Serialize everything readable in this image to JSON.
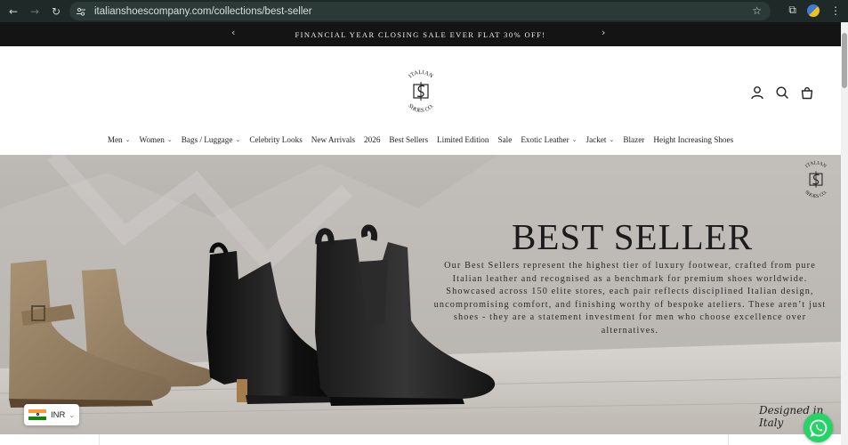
{
  "browser": {
    "url": "italianshoescompany.com/collections/best-seller"
  },
  "announcement": {
    "text": "FINANCIAL YEAR CLOSING SALE EVER FLAT 30% OFF!"
  },
  "logo": {
    "top_text": "ITALIAN",
    "bottom_text": "SHOES CO."
  },
  "nav": {
    "items": [
      {
        "label": "Men",
        "dropdown": true
      },
      {
        "label": "Women",
        "dropdown": true
      },
      {
        "label": "Bags / Luggage",
        "dropdown": true
      },
      {
        "label": "Celebrity Looks",
        "dropdown": false
      },
      {
        "label": "New Arrivals",
        "dropdown": false
      },
      {
        "label": "2026",
        "dropdown": false
      },
      {
        "label": "Best Sellers",
        "dropdown": false
      },
      {
        "label": "Limited Edition",
        "dropdown": false
      },
      {
        "label": "Sale",
        "dropdown": false
      },
      {
        "label": "Exotic Leather",
        "dropdown": true
      },
      {
        "label": "Jacket",
        "dropdown": true
      },
      {
        "label": "Blazer",
        "dropdown": false
      },
      {
        "label": "Height Increasing Shoes",
        "dropdown": false
      }
    ]
  },
  "hero": {
    "title": "BEST SELLER",
    "description": "Our Best Sellers represent the highest tier of luxury footwear, crafted from pure Italian leather and recognised as a benchmark for premium shoes worldwide. Showcased across 150 elite stores, each pair reflects disciplined Italian design, uncompromising comfort, and finishing worthy of bespoke ateliers. These aren’t just shoes - they are a statement investment for men who choose excellence over alternatives.",
    "signature": "Designed in Italy"
  },
  "currency": {
    "code": "INR"
  },
  "icons": {
    "account": "account-icon",
    "search": "search-icon",
    "cart": "cart-icon",
    "whatsapp": "whatsapp-icon"
  },
  "colors": {
    "announcement_bg": "#141414",
    "whatsapp_green": "#25d366"
  }
}
